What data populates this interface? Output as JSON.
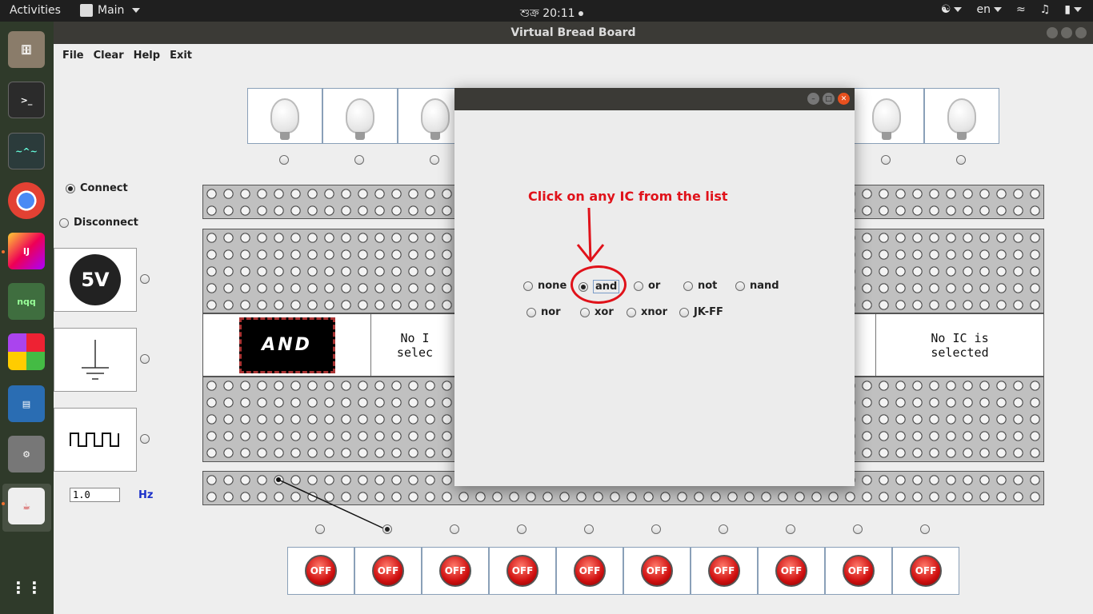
{
  "topbar": {
    "activities": "Activities",
    "app_menu": "Main",
    "clock": "শুক্র 20:11",
    "lang": "en"
  },
  "window": {
    "title": "Virtual Bread Board"
  },
  "menu": {
    "items": [
      "File",
      "Clear",
      "Help",
      "Exit"
    ]
  },
  "side": {
    "connect_label": "Connect",
    "disconnect_label": "Disconnect",
    "connect_selected": true,
    "power_label": "5V",
    "freq_value": "1.0",
    "freq_unit": "Hz"
  },
  "ic_slots": {
    "first_chip": "AND",
    "empty_text_line1": "No IC is",
    "empty_text_line2": "selected",
    "partial_line1": "No I",
    "partial_line2": "selec"
  },
  "switches": {
    "label": "OFF",
    "count": 10
  },
  "dialog": {
    "hint": "Click on any IC from the list",
    "options_row1": [
      "none",
      "and",
      "or",
      "not",
      "nand"
    ],
    "options_row2": [
      "nor",
      "xor",
      "xnor",
      "JK-FF"
    ],
    "selected": "and"
  },
  "dock": {
    "items": [
      "files-icon",
      "terminal-icon",
      "system-monitor-icon",
      "chrome-icon",
      "intellij-icon",
      "nqq-icon",
      "office-icon",
      "writer-icon",
      "settings-icon",
      "java-app-icon",
      "show-apps-icon"
    ]
  },
  "colors": {
    "accent_red": "#e0121a",
    "hz_blue": "#1a2fc9",
    "board_gray": "#c0c0c0"
  }
}
